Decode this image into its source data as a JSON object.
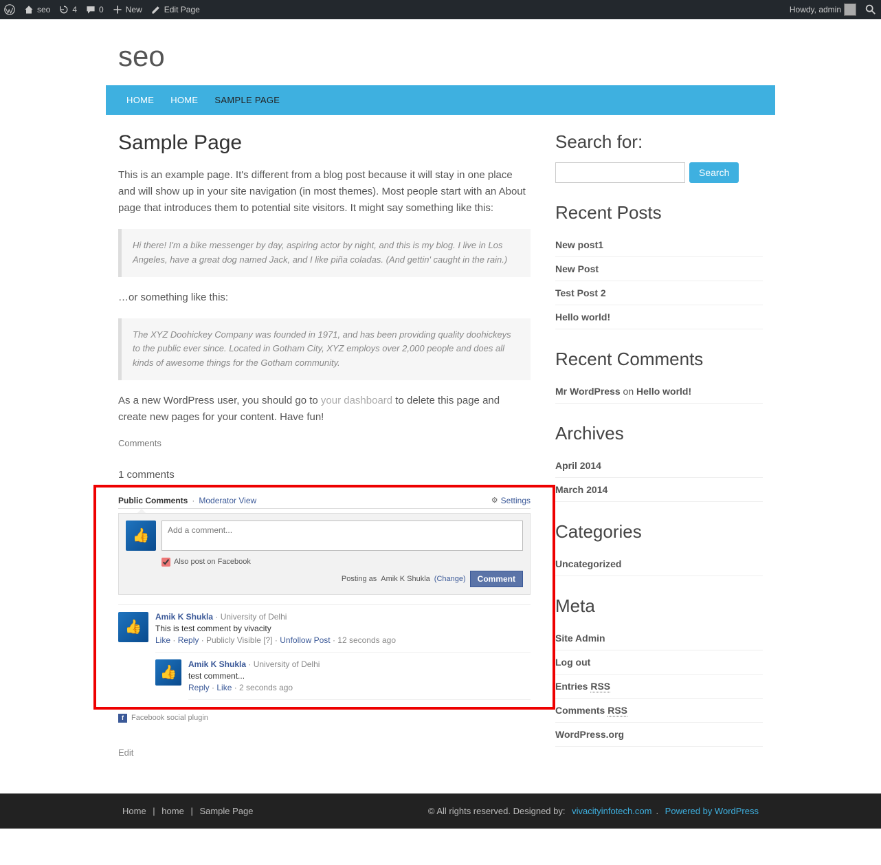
{
  "adminbar": {
    "site_name": "seo",
    "updates_count": "4",
    "comments_count": "0",
    "new_label": "New",
    "edit_page_label": "Edit Page",
    "greeting": "Howdy, admin"
  },
  "site_title": "seo",
  "nav": {
    "items": [
      {
        "label": "HOME",
        "active": false
      },
      {
        "label": "HOME",
        "active": false
      },
      {
        "label": "SAMPLE PAGE",
        "active": true
      }
    ]
  },
  "page": {
    "heading": "Sample Page",
    "p1": "This is an example page. It's different from a blog post because it will stay in one place and will show up in your site navigation (in most themes). Most people start with an About page that introduces them to potential site visitors. It might say something like this:",
    "quote1": "Hi there! I'm a bike messenger by day, aspiring actor by night, and this is my blog. I live in Los Angeles, have a great dog named Jack, and I like piña coladas. (And gettin' caught in the rain.)",
    "p2": "…or something like this:",
    "quote2": "The XYZ Doohickey Company was founded in 1971, and has been providing quality doohickeys to the public ever since. Located in Gotham City, XYZ employs over 2,000 people and does all kinds of awesome things for the Gotham community.",
    "p3a": "As a new WordPress user, you should go to ",
    "p3_link": "your dashboard",
    "p3b": " to delete this page and create new pages for your content. Have fun!",
    "comments_heading": "Comments",
    "comments_count": "1 comments",
    "edit_link": "Edit"
  },
  "fb": {
    "tab_public": "Public Comments",
    "tab_mod": "Moderator View",
    "settings": "Settings",
    "placeholder": "Add a comment...",
    "also_post": "Also post on Facebook",
    "posting_as_prefix": "Posting as ",
    "posting_as_name": "Amik K Shukla",
    "change": "(Change)",
    "comment_btn": "Comment",
    "c1": {
      "name": "Amik K Shukla",
      "sub": "University of Delhi",
      "text": "This is test comment by vivacity",
      "like": "Like",
      "reply": "Reply",
      "vis": "Publicly Visible",
      "q": "[?]",
      "unfollow": "Unfollow Post",
      "time": "12 seconds ago"
    },
    "c2": {
      "name": "Amik K Shukla",
      "sub": "University of Delhi",
      "text": "test comment...",
      "reply": "Reply",
      "like": "Like",
      "time": "2 seconds ago"
    },
    "footer": "Facebook social plugin"
  },
  "sidebar": {
    "search_title": "Search for:",
    "search_button": "Search",
    "recent_posts_title": "Recent Posts",
    "recent_posts": [
      "New post1",
      "New Post",
      "Test Post 2",
      "Hello world!"
    ],
    "recent_comments_title": "Recent Comments",
    "rc": {
      "author": "Mr WordPress",
      "on": " on ",
      "post": "Hello world!"
    },
    "archives_title": "Archives",
    "archives": [
      "April 2014",
      "March 2014"
    ],
    "categories_title": "Categories",
    "categories": [
      "Uncategorized"
    ],
    "meta_title": "Meta",
    "meta": {
      "site_admin": "Site Admin",
      "logout": "Log out",
      "entries_pre": "Entries ",
      "entries_rss": "RSS",
      "comments_pre": "Comments ",
      "comments_rss": "RSS",
      "wporg": "WordPress.org"
    }
  },
  "footer": {
    "links": [
      "Home",
      "home",
      "Sample Page"
    ],
    "rights": "© All rights reserved. Designed by: ",
    "link1": "vivacityinfotech.com",
    "sep": ". ",
    "link2": "Powered by WordPress"
  }
}
